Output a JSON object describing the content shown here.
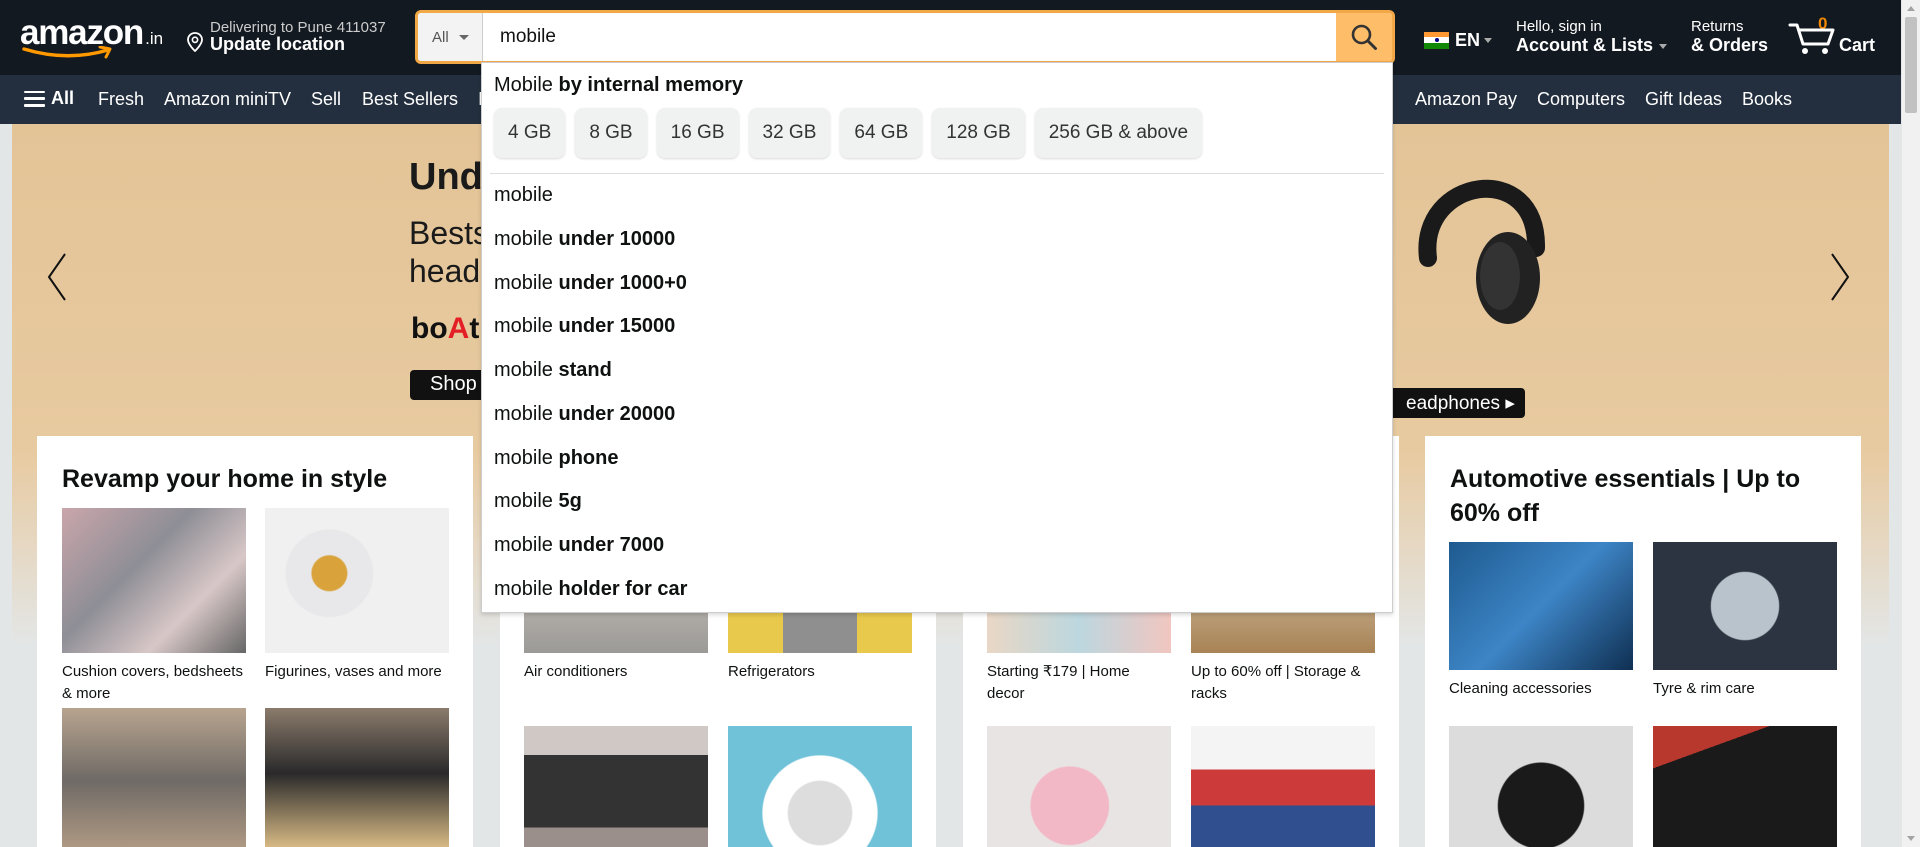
{
  "header": {
    "logo_text": "amazon",
    "logo_suffix": ".in",
    "deliver_line1": "Delivering to Pune 411037",
    "deliver_line2": "Update location",
    "search_category": "All",
    "search_value": "mobile",
    "language": "EN",
    "account_line1": "Hello, sign in",
    "account_line2": "Account & Lists",
    "orders_line1": "Returns",
    "orders_line2": "& Orders",
    "cart_count": "0",
    "cart_label": "Cart",
    "accent_color": "#febd69",
    "nav_color": "#131921"
  },
  "subnav": {
    "all_label": "All",
    "items": [
      "Fresh",
      "Amazon miniTV",
      "Sell",
      "Best Sellers",
      "Amazon Pay",
      "Computers",
      "Gift Ideas",
      "Books"
    ]
  },
  "hero": {
    "title": "Unde",
    "subtitle": "Bestse headp",
    "brand_b": "bo",
    "brand_a": "A",
    "brand_t": "t",
    "shop_label": "Shop n",
    "headphones_label": "eadphones ▸"
  },
  "cards": [
    {
      "title": "Revamp your home in style",
      "tiles": [
        {
          "caption": "Cushion covers, bedsheets & more"
        },
        {
          "caption": "Figurines, vases and more"
        },
        {
          "caption": ""
        },
        {
          "caption": ""
        }
      ]
    },
    {
      "title": "",
      "tiles": [
        {
          "caption": "Air conditioners"
        },
        {
          "caption": "Refrigerators"
        },
        {
          "caption": ""
        },
        {
          "caption": ""
        }
      ]
    },
    {
      "title": "",
      "tiles": [
        {
          "caption": "Starting ₹179 | Home decor"
        },
        {
          "caption": "Up to 60% off | Storage & racks"
        },
        {
          "caption": ""
        },
        {
          "caption": ""
        }
      ]
    },
    {
      "title": "Automotive essentials | Up to 60% off",
      "tiles": [
        {
          "caption": "Cleaning accessories"
        },
        {
          "caption": "Tyre & rim care"
        },
        {
          "caption": ""
        },
        {
          "caption": ""
        }
      ]
    }
  ],
  "autocomplete": {
    "heading_prefix": "Mobile",
    "heading_bold": "by internal memory",
    "chips": [
      "4 GB",
      "8 GB",
      "16 GB",
      "32 GB",
      "64 GB",
      "128 GB",
      "256 GB & above"
    ],
    "suggestions": [
      {
        "prefix": "mobile",
        "rest": ""
      },
      {
        "prefix": "mobile",
        "rest": "under 10000"
      },
      {
        "prefix": "mobile",
        "rest": "under 1000+0"
      },
      {
        "prefix": "mobile",
        "rest": "under 15000"
      },
      {
        "prefix": "mobile",
        "rest": "stand"
      },
      {
        "prefix": "mobile",
        "rest": "under 20000"
      },
      {
        "prefix": "mobile",
        "rest": "phone"
      },
      {
        "prefix": "mobile",
        "rest": "5g"
      },
      {
        "prefix": "mobile",
        "rest": "under 7000"
      },
      {
        "prefix": "mobile",
        "rest": "holder for car"
      }
    ]
  }
}
